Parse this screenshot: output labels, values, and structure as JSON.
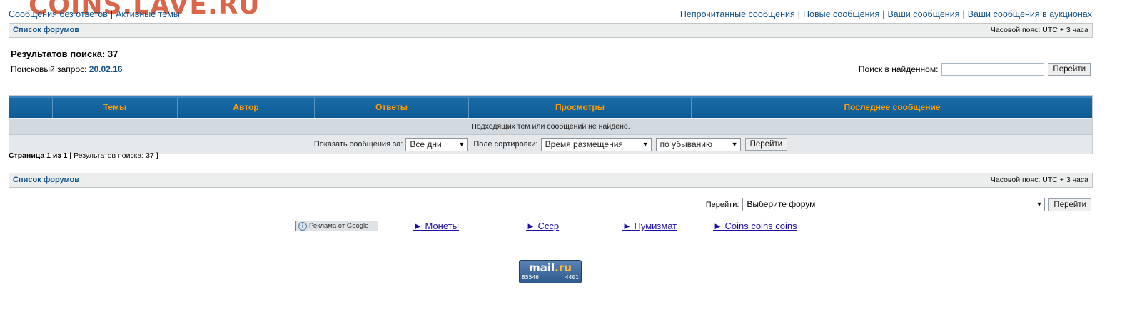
{
  "site": {
    "logo": "COINS.LAVE.RU"
  },
  "top_links_left": [
    "Сообщения без ответов",
    "Активные темы"
  ],
  "top_links_right": [
    "Непрочитанные сообщения",
    "Новые сообщения",
    "Ваши сообщения",
    "Ваши сообщения в аукционах"
  ],
  "navbar": {
    "forum_list": "Список форумов",
    "timezone": "Часовой пояс: UTC + 3 часа"
  },
  "results": {
    "title": "Результатов поиска: 37",
    "query_label": "Поисковый запрос:",
    "query_value": "20.02.16"
  },
  "search_in_found": {
    "label": "Поиск в найденном:",
    "value": "",
    "button": "Перейти"
  },
  "table": {
    "headers": [
      "Темы",
      "Автор",
      "Ответы",
      "Просмотры",
      "Последнее сообщение"
    ],
    "empty_message": "Подходящих тем или сообщений не найдено."
  },
  "sort": {
    "show_label": "Показать сообщения за:",
    "days_value": "Все дни",
    "sort_label": "Поле сортировки:",
    "sort_value": "Время размещения",
    "order_value": "по убыванию",
    "button": "Перейти"
  },
  "pagination": {
    "page_text": "Страница 1 из 1",
    "results_text": "[ Результатов поиска: 37 ]"
  },
  "jump": {
    "label": "Перейти:",
    "value": "Выберите форум",
    "button": "Перейти"
  },
  "ads": {
    "badge": "Реклама от Google",
    "links": [
      "► Монеты",
      "► Ссср",
      "► Нумизмат",
      "► Coins coins coins"
    ]
  },
  "counter": {
    "logo_main": "mail",
    "logo_dot": ".ru",
    "num_left": "85546",
    "num_right": "4401"
  }
}
